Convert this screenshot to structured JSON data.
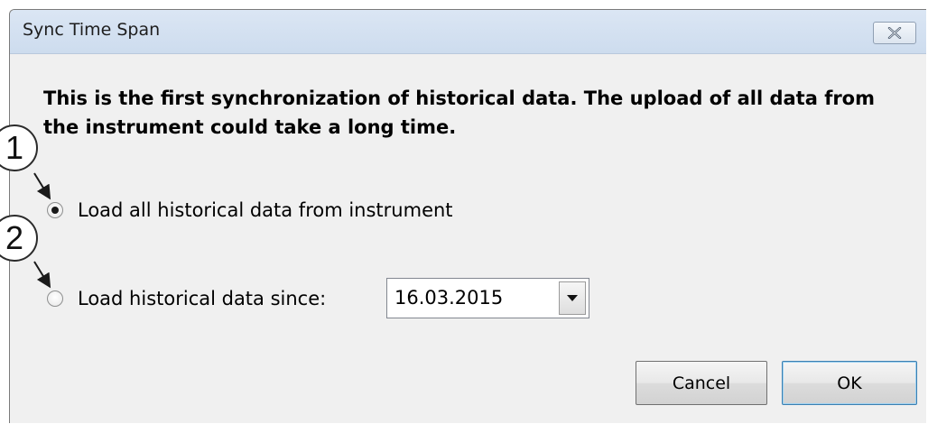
{
  "window": {
    "title": "Sync Time Span"
  },
  "message": "This is the first synchronization of historical data. The upload of all data from the instrument could take a long time.",
  "options": [
    {
      "label": "Load all historical data from instrument",
      "checked": true
    },
    {
      "label": "Load historical data since:",
      "checked": false
    }
  ],
  "date_select": {
    "value": "16.03.2015"
  },
  "buttons": {
    "cancel": "Cancel",
    "ok": "OK"
  },
  "callouts": [
    "1",
    "2"
  ],
  "icons": {
    "close": "close-icon",
    "dropdown": "chevron-down-icon"
  }
}
